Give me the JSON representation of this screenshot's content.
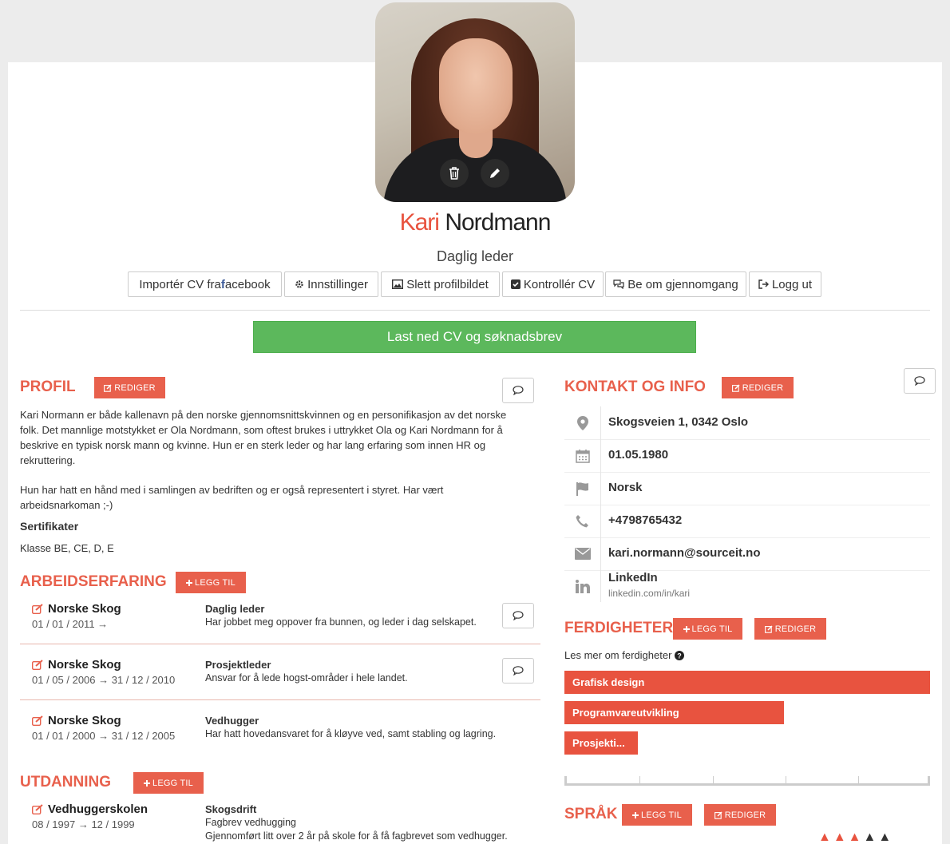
{
  "profile_header": {
    "first_name": "Kari",
    "last_name": "Nordmann",
    "job_title": "Daglig leder"
  },
  "toolbar": {
    "import_prefix": "Importér CV fra ",
    "import_fb_letter": "f",
    "import_suffix": "acebook",
    "settings": "Innstillinger",
    "delete_photo": "Slett profilbildet",
    "check_cv": "Kontrollér CV",
    "request_review": "Be om gjennomgang",
    "logout": "Logg ut"
  },
  "download_label": "Last ned CV og søknadsbrev",
  "buttons": {
    "edit": "REDIGER",
    "add": "LEGG TIL"
  },
  "profil": {
    "heading": "PROFIL",
    "para1_lines": [
      "Kari Normann er både kallenavn på den norske gjennomsnittskvinnen og en personifikasjon av det norske",
      "folk. Det mannlige motstykket er Ola Nordmann, som oftest brukes i uttrykket Ola og Kari Nordmann for å",
      "beskrive en typisk norsk mann og kvinne. Hun er en sterk leder og har lang erfaring som innen HR og",
      "rekruttering."
    ],
    "para2_lines": [
      "Hun har hatt en hånd med i samlingen av bedriften og er også representert i styret. Har vært",
      "arbeidsnarkoman ;-)"
    ],
    "cert_heading": "Sertifikater",
    "cert_value": "Klasse BE, CE, D, E"
  },
  "arbeid": {
    "heading": "ARBEIDSERFARING",
    "items": [
      {
        "company": "Norske Skog",
        "dates": "01 / 01 / 2011 →",
        "role": "Daglig leder",
        "desc": "Har jobbet meg oppover fra bunnen, og leder i dag selskapet."
      },
      {
        "company": "Norske Skog",
        "dates": "01 / 05 / 2006 → 31 / 12 / 2010",
        "role": "Prosjektleder",
        "desc": "Ansvar for å lede hogst-områder i hele landet."
      },
      {
        "company": "Norske Skog",
        "dates": "01 / 01 / 2000 → 31 / 12 / 2005",
        "role": "Vedhugger",
        "desc": "Har hatt hovedansvaret for å kløyve ved, samt stabling og lagring."
      }
    ]
  },
  "utdanning": {
    "heading": "UTDANNING",
    "items": [
      {
        "school": "Vedhuggerskolen",
        "dates": "08 / 1997 → 12 / 1999",
        "field": "Skogsdrift",
        "desc1": "Fagbrev vedhugging",
        "desc2": "Gjennomført litt over 2 år på skole for å få fagbrevet som vedhugger."
      }
    ]
  },
  "kontakt": {
    "heading": "KONTAKT OG INFO",
    "address": "Skogsveien 1, 0342 Oslo",
    "birthdate": "01.05.1980",
    "nationality": "Norsk",
    "phone": "+4798765432",
    "email": "kari.normann@sourceit.no",
    "linkedin_label": "LinkedIn",
    "linkedin_url": "linkedin.com/in/kari"
  },
  "ferdigheter": {
    "heading": "FERDIGHETER",
    "info": "Les mer om ferdigheter",
    "skills": [
      {
        "name": "Grafisk design",
        "level": 1.0
      },
      {
        "name": "Programvareutvikling",
        "level": 0.6
      },
      {
        "name": "Prosjekti...",
        "level": 0.2
      }
    ]
  },
  "sprak": {
    "heading": "SPRÅK"
  },
  "colors": {
    "accent": "#e8604c",
    "skill_bar": "#e8533f",
    "download": "#5cb85c"
  }
}
